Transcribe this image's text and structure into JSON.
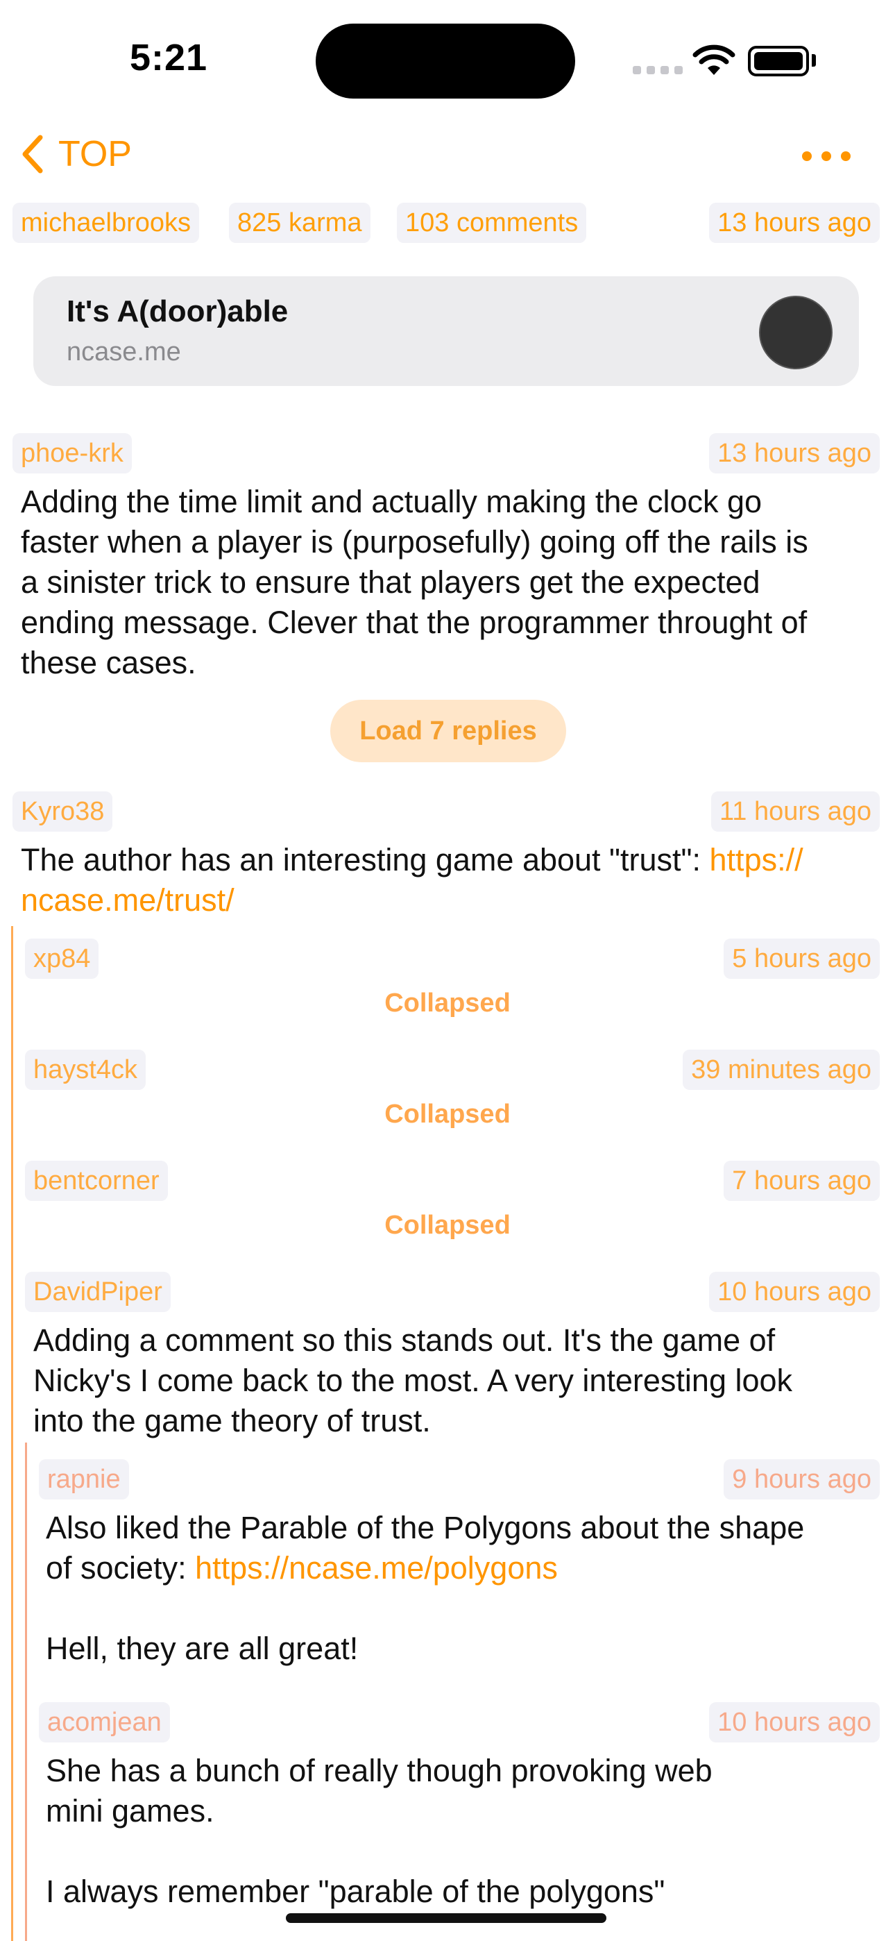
{
  "status_bar": {
    "time": "5:21"
  },
  "nav": {
    "back_label": "TOP"
  },
  "post": {
    "author": "michaelbrooks",
    "karma": "825 karma",
    "comments": "103 comments",
    "time": "13 hours ago",
    "link_title": "It's A(door)able",
    "link_domain": "ncase.me"
  },
  "comments": {
    "c1": {
      "author": "phoe-krk",
      "time": "13 hours ago",
      "body_lines": [
        "Adding the time limit and actually making the clock go",
        "faster when a player is (purposefully) going off the rails is",
        "a sinister trick to ensure that players get the expected",
        "ending message. Clever that the programmer throught of",
        "these cases."
      ],
      "load_replies": "Load 7 replies"
    },
    "c2": {
      "author": "Kyro38",
      "time": "11 hours ago",
      "body_prefix": "The author has an interesting game about \"trust\": ",
      "link_line1": "https://",
      "link_line2": "ncase.me/trust/"
    },
    "c3": {
      "author": "xp84",
      "time": "5 hours ago",
      "status": "Collapsed"
    },
    "c4": {
      "author": "hayst4ck",
      "time": "39 minutes ago",
      "status": "Collapsed"
    },
    "c5": {
      "author": "bentcorner",
      "time": "7 hours ago",
      "status": "Collapsed"
    },
    "c6": {
      "author": "DavidPiper",
      "time": "10 hours ago",
      "body_lines": [
        "Adding a comment so this stands out. It's the game of",
        "Nicky's I come back to the most. A very interesting look",
        "into the game theory of trust."
      ]
    },
    "c7": {
      "author": "rapnie",
      "time": "9 hours ago",
      "line1": "Also liked the Parable of the Polygons about the shape",
      "line2_prefix": "of society: ",
      "line2_link": "https://ncase.me/polygons",
      "line3": "Hell, they are all great!"
    },
    "c8": {
      "author": "acomjean",
      "time": "10 hours ago",
      "line1": "She has a bunch of really though provoking web",
      "line2": "mini games.",
      "line3": "I always remember \"parable of the polygons\""
    }
  },
  "colors": {
    "accent": "#ff9500",
    "tag_bg": "#f2f2f7",
    "nested_pink": "#f7a98a",
    "load_button_bg": "#ffe6c9"
  }
}
